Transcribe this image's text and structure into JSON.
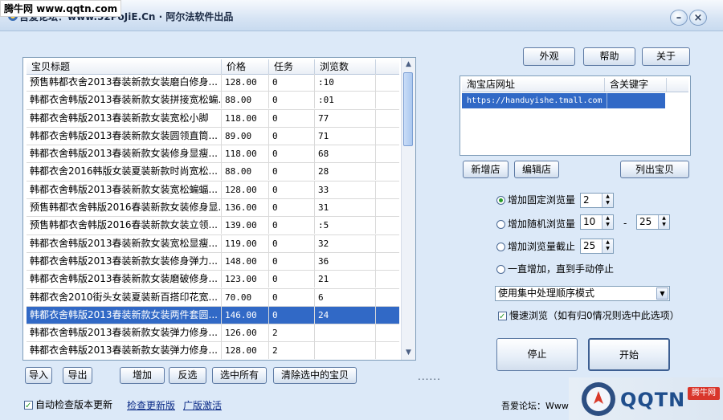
{
  "window": {
    "title": "吾爱论坛：www.52PoJiE.Cn · 阿尔法软件出品",
    "watermark_top": "腾牛网 www.qqtn.com",
    "minimize": "–",
    "close": "×"
  },
  "top_buttons": {
    "appearance": "外观",
    "help": "帮助",
    "about": "关于"
  },
  "table": {
    "columns": [
      "宝贝标题",
      "价格",
      "任务",
      "浏览数"
    ],
    "rows": [
      {
        "title": "预售韩都衣舍2013春装新款女装磨白修身...",
        "price": "128.00",
        "task": "0",
        "views": ":10"
      },
      {
        "title": "韩都衣舍韩版2013春装新款女装拼接宽松蝙...",
        "price": "88.00",
        "task": "0",
        "views": ":01"
      },
      {
        "title": "韩都衣舍韩版2013春装新款女装宽松小脚",
        "price": "118.00",
        "task": "0",
        "views": "77"
      },
      {
        "title": "韩都衣舍韩版2013春装新款女装圆领直筒...",
        "price": "89.00",
        "task": "0",
        "views": "71"
      },
      {
        "title": "韩都衣舍韩版2013春装新款女装修身显瘦...",
        "price": "118.00",
        "task": "0",
        "views": "68"
      },
      {
        "title": "韩都衣舍2016韩版女装夏装新款时尚宽松...",
        "price": "88.00",
        "task": "0",
        "views": "28"
      },
      {
        "title": "韩都衣舍韩版2013春装新款女装宽松蝙蝠...",
        "price": "128.00",
        "task": "0",
        "views": "33"
      },
      {
        "title": "预售韩都衣舍韩版2016春装新款女装修身显...",
        "price": "136.00",
        "task": "0",
        "views": "31"
      },
      {
        "title": "预售韩都衣舍韩版2016春装新款女装立领...",
        "price": "139.00",
        "task": "0",
        "views": ":5"
      },
      {
        "title": "韩都衣舍韩版2013春装新款女装宽松显瘦...",
        "price": "119.00",
        "task": "0",
        "views": "32"
      },
      {
        "title": "韩都衣舍韩版2013春装新款女装修身弹力...",
        "price": "148.00",
        "task": "0",
        "views": "36"
      },
      {
        "title": "韩都衣舍韩版2013春装新款女装磨破修身...",
        "price": "123.00",
        "task": "0",
        "views": "21"
      },
      {
        "title": "韩都衣舍2010街头女装夏装新百搭印花宽...",
        "price": "70.00",
        "task": "0",
        "views": "6"
      },
      {
        "title": "韩都衣舍韩版2013春装新款女装两件套圆...",
        "price": "146.00",
        "task": "0",
        "views": "24"
      },
      {
        "title": "韩都衣舍韩版2013春装新款女装弹力修身...",
        "price": "126.00",
        "task": "2",
        "views": ""
      },
      {
        "title": "韩都衣舍韩版2013春装新款女装弹力修身...",
        "price": "128.00",
        "task": "2",
        "views": ""
      }
    ]
  },
  "store_list": {
    "columns": [
      "淘宝店网址",
      "含关键字"
    ],
    "rows": [
      {
        "url": "https://handuyishe.tmall.com",
        "keyword": ""
      }
    ]
  },
  "store_buttons": {
    "add": "新增店",
    "edit": "编辑店",
    "list": "列出宝贝"
  },
  "options": {
    "fixed_label": "增加固定浏览量",
    "fixed_value": "2",
    "random_label": "增加随机浏览量",
    "random_min": "10",
    "random_sep": "-",
    "random_max": "25",
    "cutoff_label": "增加浏览量截止",
    "cutoff_value": "25",
    "forever_label": "一直增加，直到手动停止",
    "mode_value": "使用集中处理顺序模式",
    "slow_label": "慢速浏览（如有归0情况则选中此选项）"
  },
  "actions": {
    "stop": "停止",
    "start": "开始"
  },
  "bottom_buttons": {
    "import": "导入",
    "export": "导出",
    "add": "增加",
    "invert": "反选",
    "select_all": "选中所有",
    "clear": "清除选中的宝贝"
  },
  "footer": {
    "auto_check": "自动检查版本更新",
    "check_update": "检查更新版",
    "activate": "广版激活",
    "dots": "......",
    "forum": "吾爱论坛：Www.52",
    "bottom_watermark": "QQTN",
    "bottom_watermark_badge": "腾牛网"
  },
  "colors": {
    "selection": "#3169c6",
    "window_bg": "#dce9f8",
    "radio_dot": "#2a9a2a"
  }
}
